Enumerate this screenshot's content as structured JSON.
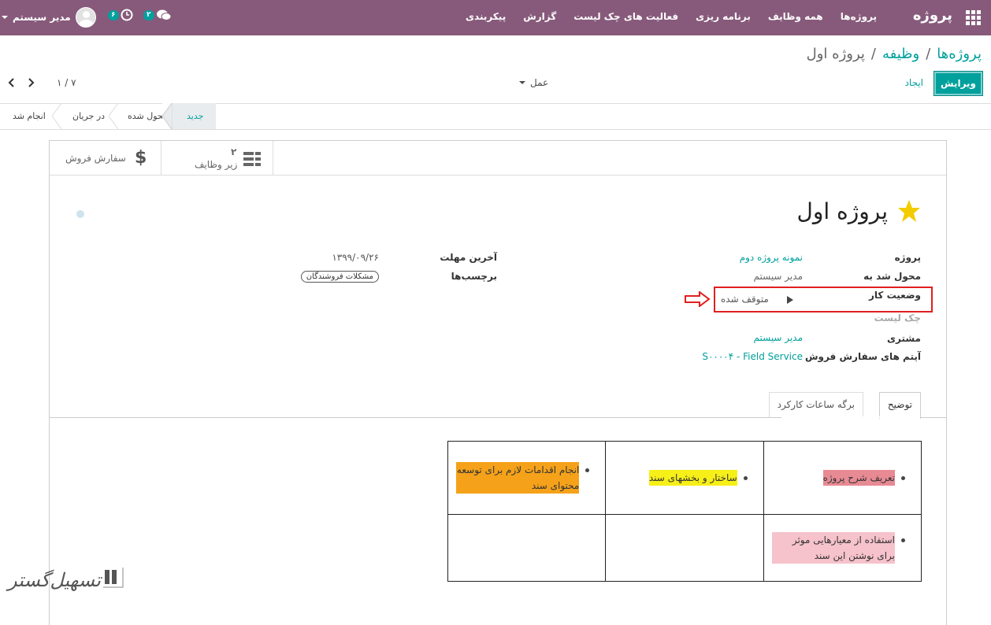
{
  "nav": {
    "brand": "پروژه",
    "menu": [
      "پروژه‌ها",
      "همه وظایف",
      "برنامه ریزی",
      "فعالیت های چک لیست",
      "گزارش",
      "پیکربندی"
    ],
    "user_name": "مدیر سیستم",
    "activity_count": "۶",
    "messages_count": "۲"
  },
  "breadcrumb": {
    "root": "پروژه‌ها",
    "parent": "وظیفه",
    "current": "پروژه اول",
    "sep": "/"
  },
  "buttons": {
    "edit": "ویرایش",
    "create": "ایجاد",
    "action": "عمل"
  },
  "pager": {
    "text": "۱ / ۷"
  },
  "stages": {
    "new": "جدید",
    "assigned": "محول شده",
    "in_progress": "در جریان",
    "done": "انجام شد",
    "active": "new"
  },
  "smart_buttons": {
    "subtasks_label": "زیر وظایف",
    "subtasks_count": "۲",
    "sale_order_label": "سفارش فروش"
  },
  "record": {
    "title": "پروژه اول",
    "starred": true,
    "fields_right": {
      "project_label": "پروژه",
      "project_value": "نمونه پروژه دوم",
      "assigned_label": "محول شد به",
      "assigned_value": "مدیر سیستم",
      "status_label": "وضعیت کار",
      "status_value": "متوقف شده",
      "checklist_label": "چک لیست",
      "customer_label": "مشتری",
      "customer_value": "مدیر سیستم",
      "so_item_label": "آیتم های سفارش فروش",
      "so_item_value": "S۰۰۰۰۴ - Field Service"
    },
    "fields_left": {
      "deadline_label": "آخرین مهلت",
      "deadline_value": "۱۳۹۹/۰۹/۲۶",
      "tags_label": "برچسب‌ها",
      "tag": "مشکلات فروشندگان"
    }
  },
  "tabs": {
    "description": "توضیح",
    "timesheets": "برگه ساعات کارکرد",
    "active": "description"
  },
  "description_table": {
    "cells": [
      "تعریف شرح پروژه",
      "ساختار و بخشهای سند",
      "انجام اقدامات لازم برای توسعه محتوای سند",
      "استفاده از معیارهایی موثر برای نوشتن این سند"
    ],
    "highlight_colors": {
      "red": "#e88a94",
      "yellow": "#f7ef18",
      "orange": "#f5a21a",
      "pink": "#f6c2cb"
    }
  },
  "colors": {
    "nav_bg": "#875a7b",
    "accent": "#00a09d",
    "annotation_red": "#e02020"
  },
  "watermark": {
    "text": "تسهیل‌گستر"
  }
}
